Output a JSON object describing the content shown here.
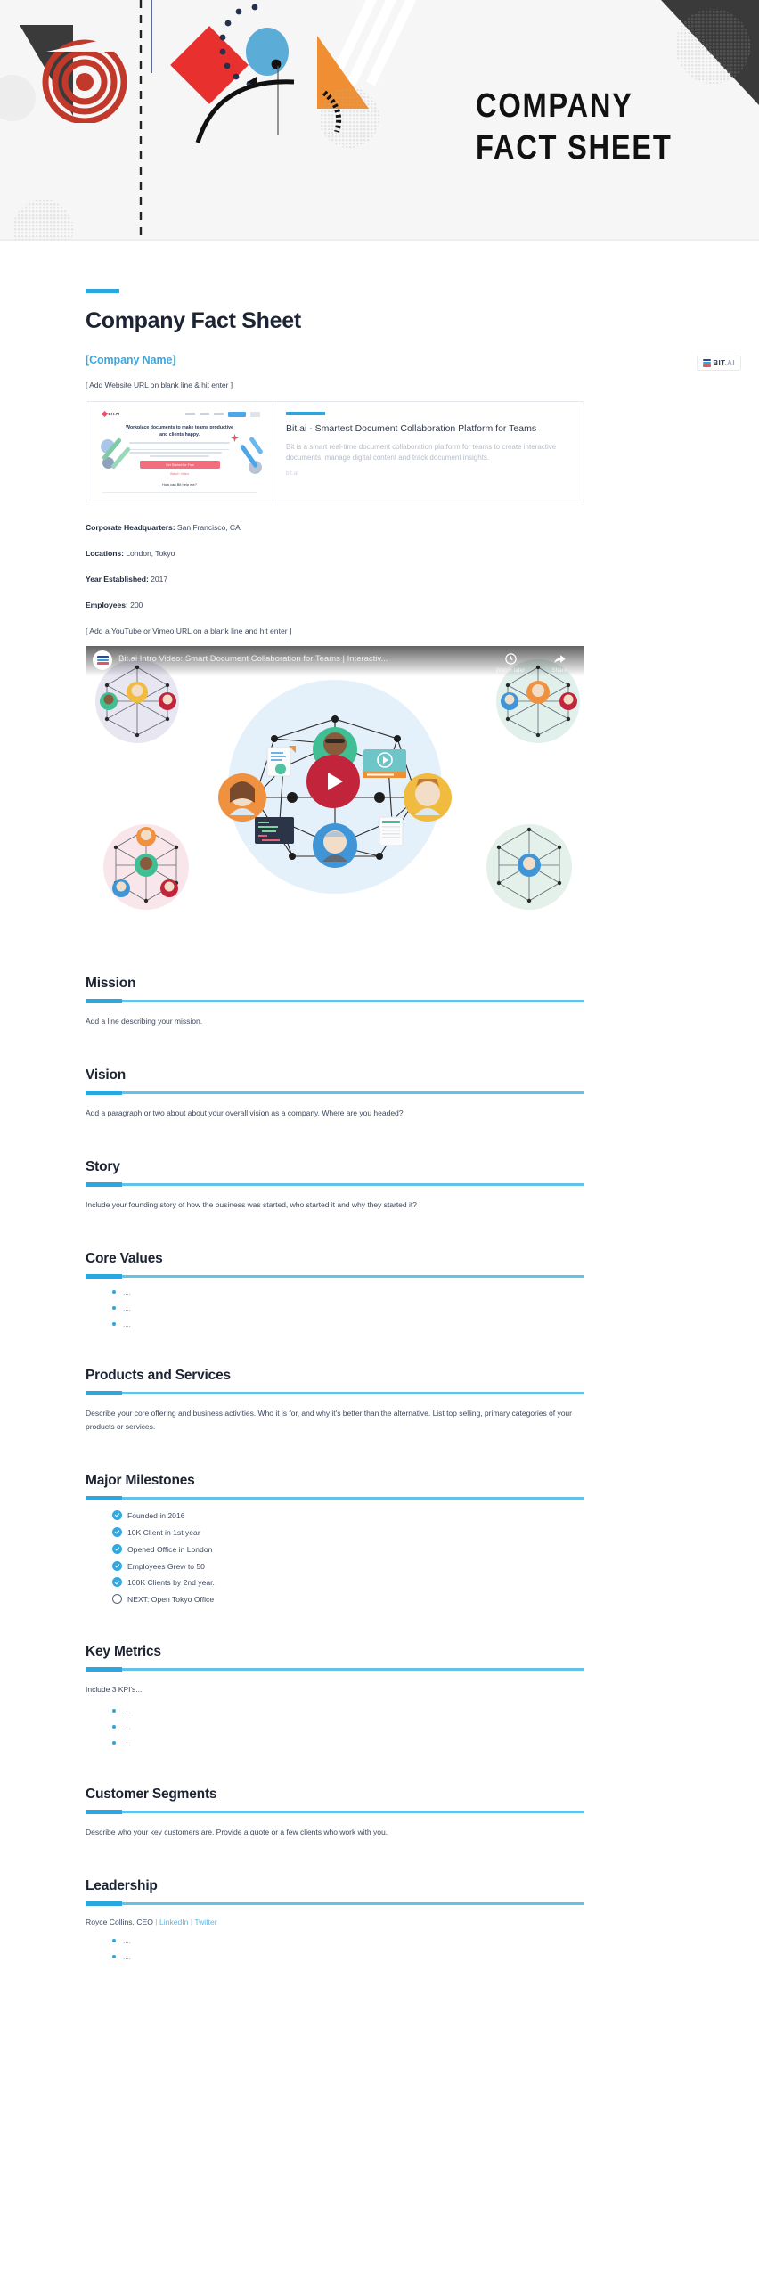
{
  "banner": {
    "title_line1": "COMPANY",
    "title_line2": "FACT SHEET"
  },
  "brand": {
    "badge_name": "BIT",
    "badge_suffix": ".AI",
    "accent_color": "#2ba6de",
    "link_color": "#5bb9e8",
    "heading_color": "#1c2433",
    "body_color": "#3f4a5e"
  },
  "document": {
    "title": "Company Fact Sheet",
    "company_name": "[Company Name]",
    "website_hint": "[ Add Website URL on blank line & hit enter ]",
    "video_hint": "[ Add a YouTube or Vimeo URL on a blank line and hit enter ]"
  },
  "link_preview": {
    "title": "Bit.ai - Smartest Document Collaboration Platform for Teams",
    "description": "Bit is a smart real-time document collaboration platform for teams to create interactive documents, manage digital content and track document insights.",
    "url": "bit.ai",
    "thumb_logo": "BIT.AI",
    "thumb_headline": "Workplace documents to make teams productive and clients happy.",
    "thumb_cta": "Get Started for Free",
    "thumb_subcta": "Watch Video",
    "thumb_helper": "How can Bit help me?"
  },
  "facts": [
    {
      "label": "Corporate Headquarters:",
      "value": "San Francisco, CA"
    },
    {
      "label": "Locations:",
      "value": "London, Tokyo"
    },
    {
      "label": "Year Established:",
      "value": "2017"
    },
    {
      "label": "Employees:",
      "value": "200"
    }
  ],
  "video": {
    "title": "Bit.ai Intro Video: Smart Document Collaboration for Teams | Interactiv...",
    "watch_later_label": "Watch later",
    "share_label": "Share",
    "play_icon": "play-icon",
    "clock_icon": "clock-icon",
    "share_icon": "share-icon"
  },
  "sections": [
    {
      "id": "mission",
      "title": "Mission",
      "body": "Add a line describing your mission."
    },
    {
      "id": "vision",
      "title": "Vision",
      "body": "Add a paragraph or two about about your overall vision as a company. Where are you headed?"
    },
    {
      "id": "story",
      "title": "Story",
      "body": "Include your founding story of how the business was started, who started it and why they started it?"
    },
    {
      "id": "core-values",
      "title": "Core Values",
      "bullets": [
        "....",
        "....",
        "...."
      ]
    },
    {
      "id": "products-and-services",
      "title": "Products and Services",
      "body": "Describe your core offering and business activities. Who it is for, and why it's better than the alternative. List top selling, primary categories of your products or services."
    },
    {
      "id": "major-milestones",
      "title": "Major Milestones",
      "checklist": [
        {
          "label": "Founded in 2016",
          "checked": true
        },
        {
          "label": "10K Client in 1st year",
          "checked": true
        },
        {
          "label": "Opened Office in London",
          "checked": true
        },
        {
          "label": "Employees Grew to 50",
          "checked": true
        },
        {
          "label": "100K Clients by 2nd year.",
          "checked": true
        },
        {
          "label": "NEXT: Open Tokyo Office",
          "checked": false
        }
      ]
    },
    {
      "id": "key-metrics",
      "title": "Key Metrics",
      "body": "Include 3 KPI's...",
      "bullets": [
        "....",
        "....",
        "...."
      ]
    },
    {
      "id": "customer-segments",
      "title": "Customer Segments",
      "body": "Describe who your key customers are. Provide a quote or a few clients who work with you."
    },
    {
      "id": "leadership",
      "title": "Leadership",
      "leader_name": "Royce Collins, CEO",
      "links": [
        "LinkedIn",
        "Twitter"
      ],
      "bullets": [
        "....",
        "...."
      ]
    }
  ]
}
